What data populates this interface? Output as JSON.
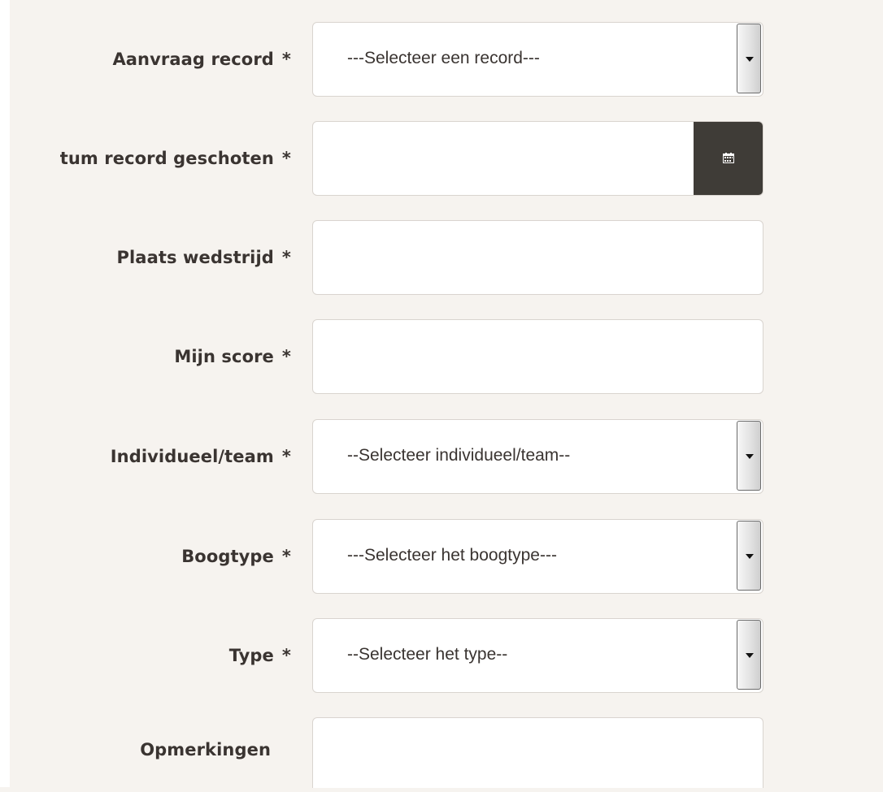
{
  "form": {
    "required_marker": "*",
    "fields": [
      {
        "id": "aanvraag_record",
        "label": "Aanvraag record",
        "required": true,
        "type": "select",
        "value": "---Selecteer een record---"
      },
      {
        "id": "datum_record",
        "label": "tum record geschoten",
        "required": true,
        "type": "date",
        "value": ""
      },
      {
        "id": "plaats_wedstrijd",
        "label": "Plaats wedstrijd",
        "required": true,
        "type": "text",
        "value": ""
      },
      {
        "id": "mijn_score",
        "label": "Mijn score",
        "required": true,
        "type": "text",
        "value": ""
      },
      {
        "id": "individueel_team",
        "label": "Individueel/team",
        "required": true,
        "type": "select",
        "value": "--Selecteer individueel/team--"
      },
      {
        "id": "boogtype",
        "label": "Boogtype",
        "required": true,
        "type": "select",
        "value": "---Selecteer het boogtype---"
      },
      {
        "id": "type",
        "label": "Type",
        "required": true,
        "type": "select",
        "value": "--Selecteer het type--"
      },
      {
        "id": "opmerkingen",
        "label": "Opmerkingen",
        "required": false,
        "type": "textarea",
        "value": ""
      }
    ],
    "icons": {
      "date_picker": "calendar-icon",
      "select_arrow": "chevron-down-icon"
    }
  },
  "colors": {
    "page_background": "#f6f3ef",
    "label_text": "#3a3431",
    "field_border": "#d9d4cf",
    "calendar_button": "#3f3c37"
  }
}
